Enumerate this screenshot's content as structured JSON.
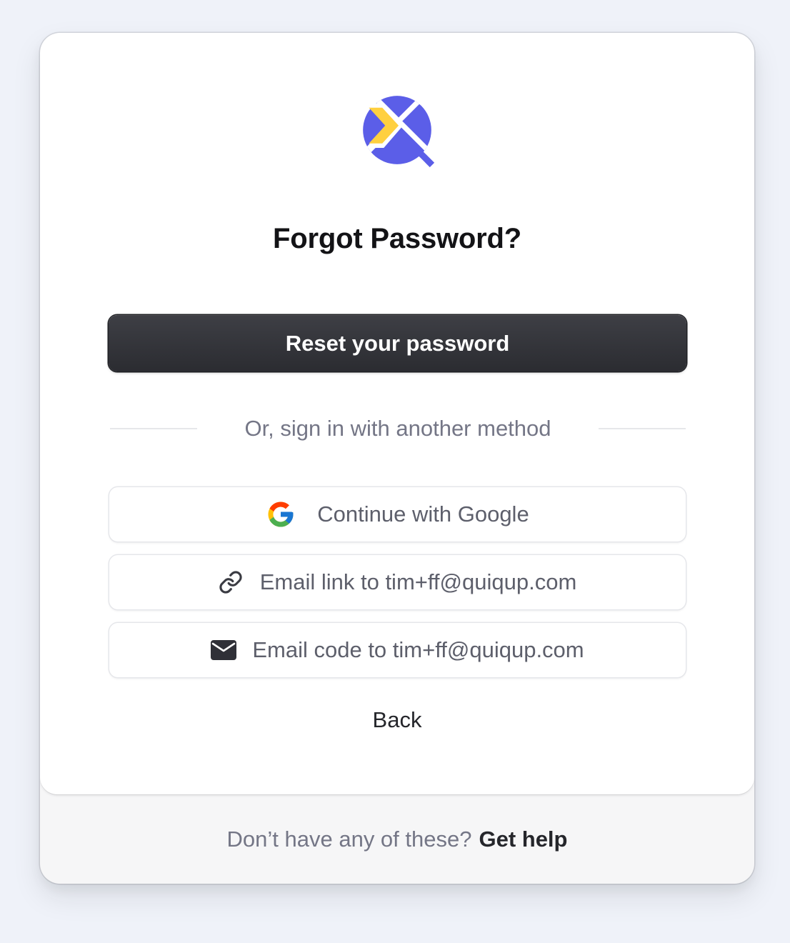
{
  "brand": {
    "logo_icon": "quiqup-logo-icon",
    "colors": {
      "primary": "#5b5ee8",
      "accent": "#ffd03f"
    }
  },
  "page": {
    "title": "Forgot Password?"
  },
  "primary_action": {
    "label": "Reset your password"
  },
  "divider": {
    "text": "Or, sign in with another method"
  },
  "alternatives": [
    {
      "icon": "google-icon",
      "label": "Continue with Google"
    },
    {
      "icon": "link-icon",
      "label": "Email link to tim+ff@quiqup.com"
    },
    {
      "icon": "envelope-icon",
      "label": "Email code to tim+ff@quiqup.com"
    }
  ],
  "back": {
    "label": "Back"
  },
  "footer": {
    "text": "Don’t have any of these?",
    "link_label": "Get help"
  }
}
